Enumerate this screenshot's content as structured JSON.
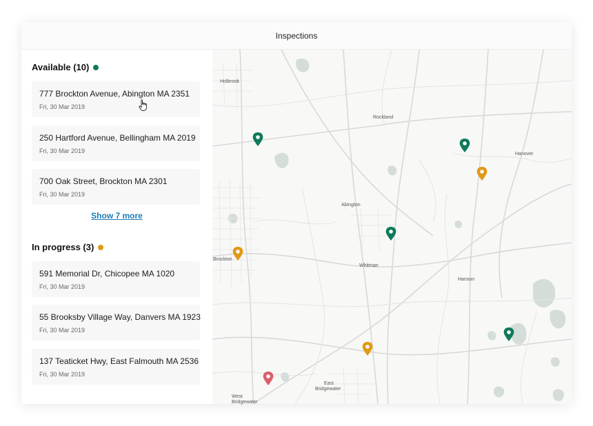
{
  "window": {
    "title": "Inspections"
  },
  "colors": {
    "available": "#0f7a5a",
    "in_progress": "#e09a16",
    "overdue": "#d9606a",
    "link": "#1e7bb8"
  },
  "sections": {
    "available": {
      "label": "Available (10)",
      "items": [
        {
          "address": "777 Brockton Avenue, Abington MA 2351",
          "date": "Fri, 30 Mar 2019"
        },
        {
          "address": "250 Hartford Avenue, Bellingham MA 2019",
          "date": "Fri, 30 Mar 2019"
        },
        {
          "address": "700 Oak Street, Brockton MA 2301",
          "date": "Fri, 30 Mar 2019"
        }
      ],
      "show_more": "Show 7 more"
    },
    "in_progress": {
      "label": "In progress (3)",
      "items": [
        {
          "address": "591 Memorial Dr, Chicopee MA 1020",
          "date": "Fri, 30 Mar 2019"
        },
        {
          "address": "55 Brooksby Village Way, Danvers MA 1923",
          "date": "Fri, 30 Mar 2019"
        },
        {
          "address": "137 Teaticket Hwy, East Falmouth MA 2536",
          "date": "Fri, 30 Mar 2019"
        }
      ]
    }
  },
  "map": {
    "places": [
      "Holbrook",
      "Rockland",
      "Hanover",
      "Abington",
      "Brockton",
      "Whitman",
      "Hanson",
      "East Bridgewater",
      "West Bridgewater"
    ],
    "markers": [
      "available",
      "available",
      "in_progress",
      "available",
      "in_progress",
      "available",
      "in_progress",
      "overdue"
    ]
  }
}
